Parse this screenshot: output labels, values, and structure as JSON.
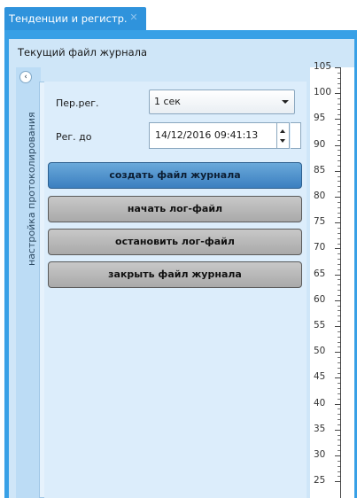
{
  "tab": {
    "label": "Тенденции и регистр.",
    "close_icon": "close-icon"
  },
  "file_title": "Текущий файл журнала",
  "side_panel": {
    "label": "настройка протоколирования",
    "collapse_icon": "chevron-left-icon"
  },
  "settings": {
    "period_label": "Пер.рег.",
    "period_value": "1 сек",
    "until_label": "Рег. до",
    "until_value": "14/12/2016 09:41:13"
  },
  "buttons": {
    "create": "создать файл журнала",
    "start": "начать лог-файл",
    "stop": "остановить лог-файл",
    "close": "закрыть файл журнала"
  },
  "axis": {
    "ticks": [
      "105",
      "100",
      "95",
      "90",
      "85",
      "80",
      "75",
      "70",
      "65",
      "60",
      "55",
      "50",
      "45",
      "40",
      "35",
      "30",
      "25"
    ]
  },
  "colors": {
    "accent": "#2f93dc",
    "background": "#cfe6f8",
    "primary_button": "#4a90d0",
    "button": "#b4b4b4"
  }
}
